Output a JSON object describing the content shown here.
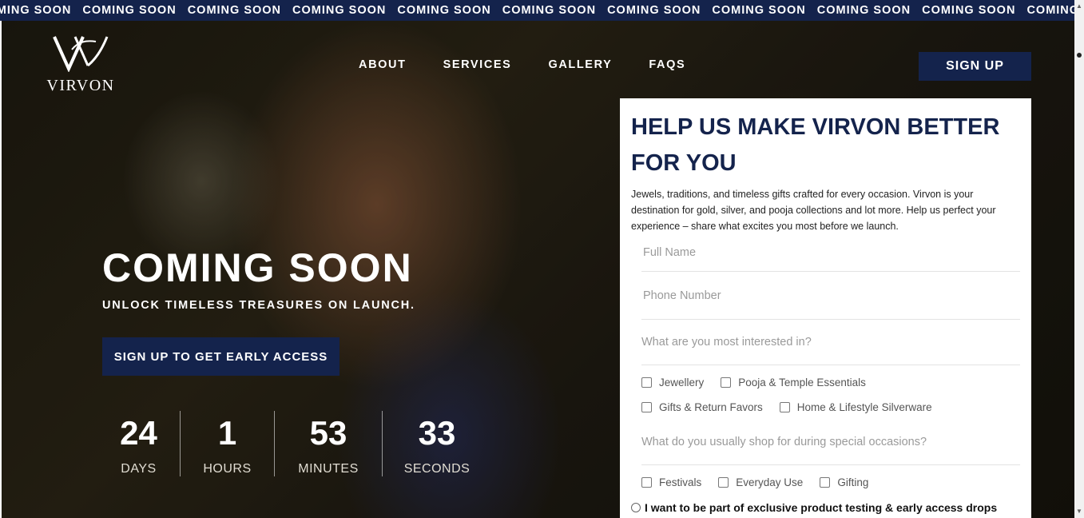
{
  "ticker": {
    "items": [
      "COMING SOON",
      "COMING SOON",
      "COMING SOON",
      "COMING SOON",
      "COMING SOON",
      "COMING SOON",
      "COMING SOON",
      "COMING SOON",
      "COMING SOON",
      "COMING SOON",
      "COMING SOON"
    ]
  },
  "brand": {
    "name": "VIRVON",
    "logo_icon": "vv-monogram-icon"
  },
  "nav": {
    "items": [
      "ABOUT",
      "SERVICES",
      "GALLERY",
      "FAQS"
    ],
    "signup_label": "SIGN UP"
  },
  "hero": {
    "title": "COMING SOON",
    "subtitle": "UNLOCK TIMELESS TREASURES ON LAUNCH.",
    "cta_label": "SIGN UP TO GET EARLY ACCESS",
    "countdown": [
      {
        "value": "24",
        "label": "DAYS"
      },
      {
        "value": "1",
        "label": "HOURS"
      },
      {
        "value": "53",
        "label": "MINUTES"
      },
      {
        "value": "33",
        "label": "SECONDS"
      }
    ]
  },
  "form": {
    "title": "HELP US MAKE VIRVON BETTER FOR YOU",
    "description": "Jewels, traditions, and timeless gifts crafted for every occasion. Virvon is your destination for gold, silver, and pooja collections and lot more. Help us perfect your experience – share what excites you most before we launch.",
    "full_name_placeholder": "Full Name",
    "phone_placeholder": "Phone Number",
    "interest_question": "What are you most interested in?",
    "interest_options": [
      "Jewellery",
      "Pooja & Temple Essentials",
      "Gifts & Return Favors",
      "Home & Lifestyle Silverware"
    ],
    "occasion_question": "What do you usually shop for during special occasions?",
    "occasion_options": [
      "Festivals",
      "Everyday Use",
      "Gifting"
    ],
    "consent_label": "I want to be part of exclusive product testing & early access drops"
  },
  "colors": {
    "navy": "#14234c",
    "white": "#ffffff"
  }
}
